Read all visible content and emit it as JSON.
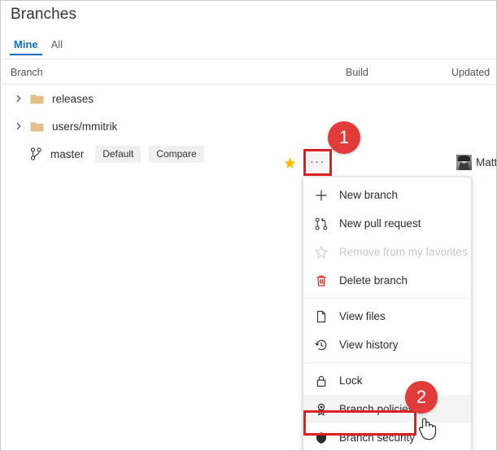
{
  "page": {
    "title": "Branches"
  },
  "tabs": [
    {
      "label": "Mine",
      "selected": true
    },
    {
      "label": "All",
      "selected": false
    }
  ],
  "table": {
    "columns": {
      "branch": "Branch",
      "build": "Build",
      "updated": "Updated"
    },
    "rows": [
      {
        "type": "folder",
        "label": "releases"
      },
      {
        "type": "folder",
        "label": "users/mmitrik"
      },
      {
        "type": "branch",
        "label": "master",
        "pills": [
          "Default",
          "Compare"
        ],
        "favorited": true,
        "user": "Matt"
      }
    ]
  },
  "row_actions": {
    "star_title": "Favorite",
    "ellipsis_label": "···"
  },
  "context_menu": {
    "items": [
      {
        "icon": "plus-icon",
        "label": "New branch",
        "state": "normal"
      },
      {
        "icon": "pull-request-icon",
        "label": "New pull request",
        "state": "normal"
      },
      {
        "icon": "star-outline-icon",
        "label": "Remove from my favorites",
        "state": "disabled"
      },
      {
        "icon": "trash-icon",
        "label": "Delete branch",
        "state": "danger"
      },
      {
        "separator": true
      },
      {
        "icon": "file-icon",
        "label": "View files",
        "state": "normal"
      },
      {
        "icon": "history-icon",
        "label": "View history",
        "state": "normal"
      },
      {
        "separator": true
      },
      {
        "icon": "lock-icon",
        "label": "Lock",
        "state": "normal"
      },
      {
        "icon": "policy-icon",
        "label": "Branch policies",
        "state": "highlighted"
      },
      {
        "icon": "shield-icon",
        "label": "Branch security",
        "state": "normal"
      }
    ]
  },
  "callouts": [
    {
      "number": "1",
      "target": "ellipsis-button"
    },
    {
      "number": "2",
      "target": "branch-policies-menu-item"
    }
  ],
  "colors": {
    "accent": "#106ebe",
    "callout_red": "#e23b3b",
    "outline_red": "#e02020",
    "danger": "#d42b1f",
    "folder": "#e3c08d",
    "star": "#ffb900"
  }
}
